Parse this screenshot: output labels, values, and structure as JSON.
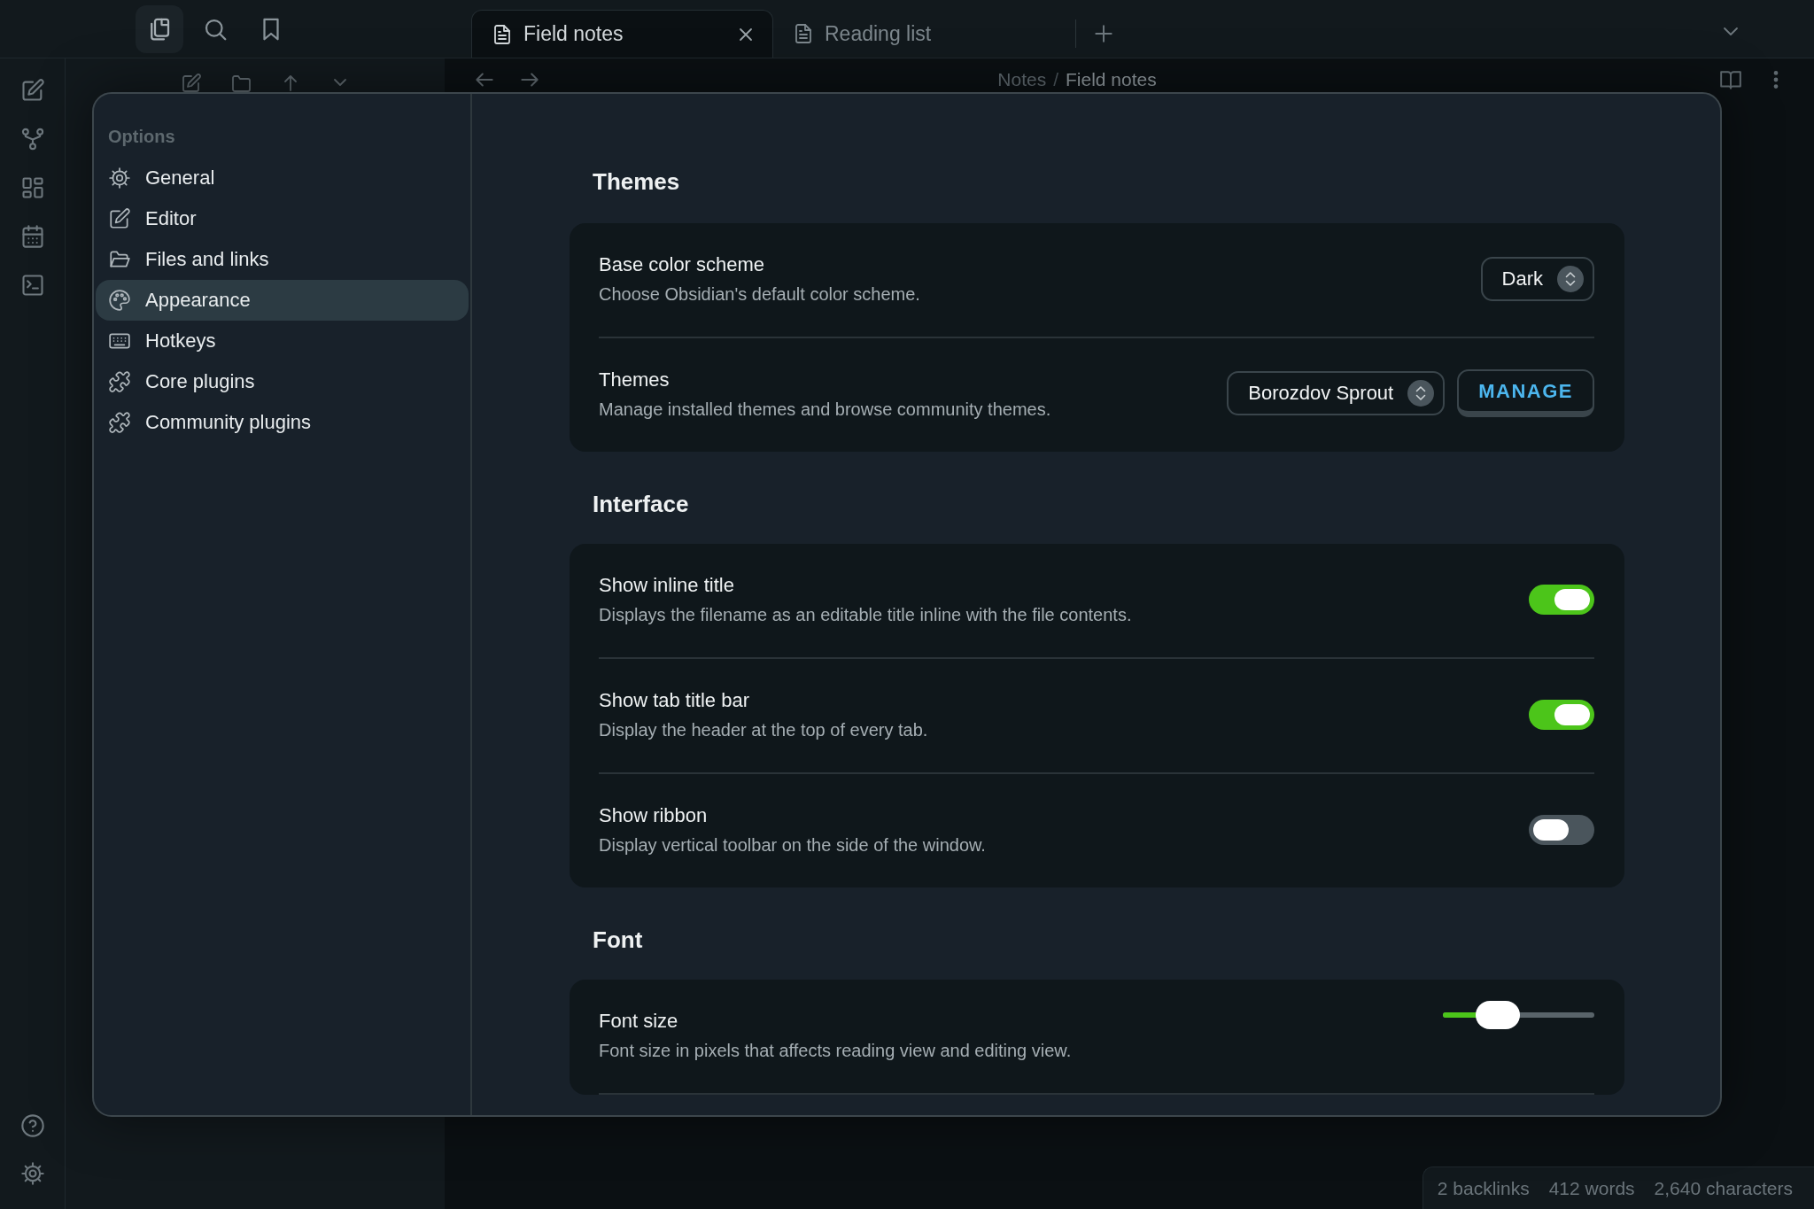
{
  "tabs": [
    {
      "label": "Field notes",
      "selected": true
    },
    {
      "label": "Reading list",
      "selected": false
    }
  ],
  "breadcrumb": {
    "folder": "Notes",
    "separator": "/",
    "file": "Field notes"
  },
  "settings": {
    "sidebar_title": "Options",
    "items": [
      {
        "label": "General",
        "selected": false
      },
      {
        "label": "Editor",
        "selected": false
      },
      {
        "label": "Files and links",
        "selected": false
      },
      {
        "label": "Appearance",
        "selected": true
      },
      {
        "label": "Hotkeys",
        "selected": false
      },
      {
        "label": "Core plugins",
        "selected": false
      },
      {
        "label": "Community plugins",
        "selected": false
      }
    ],
    "sections": [
      {
        "title": "Themes",
        "rows": [
          {
            "kind": "dropdown",
            "name": "Base color scheme",
            "description": "Choose Obsidian's default color scheme.",
            "value": "Dark"
          },
          {
            "kind": "dropdown_button",
            "name": "Themes",
            "description": "Manage installed themes and browse community themes.",
            "value": "Borozdov Sprout",
            "button": "MANAGE"
          }
        ]
      },
      {
        "title": "Interface",
        "rows": [
          {
            "kind": "toggle",
            "name": "Show inline title",
            "description": "Displays the filename as an editable title inline with the file contents.",
            "on": true
          },
          {
            "kind": "toggle",
            "name": "Show tab title bar",
            "description": "Display the header at the top of every tab.",
            "on": true
          },
          {
            "kind": "toggle",
            "name": "Show ribbon",
            "description": "Display vertical toolbar on the side of the window.",
            "on": false
          }
        ]
      },
      {
        "title": "Font",
        "rows": [
          {
            "kind": "slider",
            "name": "Font size",
            "description": "Font size in pixels that affects reading view and editing view.",
            "level": 0.36
          }
        ]
      }
    ]
  },
  "status_bar": [
    "2 backlinks",
    "412 words",
    "2,640 characters"
  ]
}
